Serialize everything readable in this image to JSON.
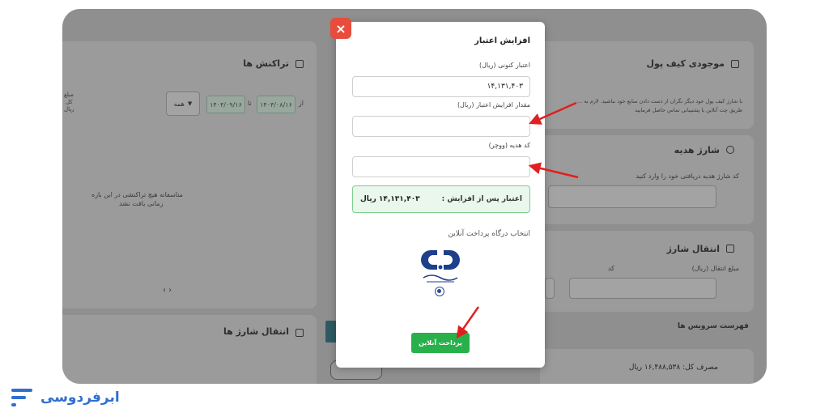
{
  "background": {
    "right": {
      "wallet_title": "موجودی کیف پول",
      "wallet_desc_1": "با شارژ کیف پول خود دیگر نگران از دست دادن منابع خود نباشید. لازم به ...",
      "wallet_desc_2": "طریق چت آنلاین یا پشتیبانی تماس حاصل فرمایید",
      "gift_title": "شارژ هدیه",
      "gift_desc": "کد شارژ هدیه دریافتی خود را وارد کنید",
      "transfer_title": "انتقال شارژ",
      "transfer_amount_label": "مبلغ انتقال (ریال)",
      "transfer_code_label": "کد",
      "services_title": "فهرست سرویس ها",
      "usage_total": "مصرف کل: ۱۶,۴۸۸,۵۳۸ ریال"
    },
    "left": {
      "transactions_title": "تراکنش ها",
      "from_label": "از",
      "from_date": "۱۴۰۴/۰۸/۱۶",
      "to_label": "تا",
      "to_date": "۱۴۰۴/۰۹/۱۶",
      "filter_value": "همه",
      "col_amount_1": "مبلغ",
      "col_amount_2": "کل",
      "col_amount_3": "ریال",
      "empty_msg_1": "متاسفانه هیچ تراکنشی در این بازه",
      "empty_msg_2": "زمانی یافت نشد",
      "pager": "‹  ›",
      "transfer_title": "انتقال شارژ ها"
    }
  },
  "modal": {
    "title": "افزایش اعتبار",
    "current_credit_label": "اعتبار کنونی (ریال)",
    "current_credit_value": "۱۴,۱۳۱,۴۰۳",
    "increase_label": "مقدار افزایش اعتبار (ریال)",
    "increase_value": "",
    "voucher_label": "کد هدیه (ووچر)",
    "voucher_value": "",
    "after_label": "اعتبار پس از افزایش :",
    "after_value": "۱۴,۱۳۱,۴۰۳ ریال",
    "gateway_title": "انتخاب درگاه پرداخت آنلاین",
    "bank_caption": "بانک رفاه کارگران",
    "pay_button": "پرداخت آنلاین",
    "close": "×"
  },
  "brand": {
    "name": "ابرفردوسی"
  },
  "colors": {
    "accent": "#28b04a",
    "close": "#e74c3c",
    "arrow": "#e02020",
    "brand": "#2f6fd1"
  }
}
